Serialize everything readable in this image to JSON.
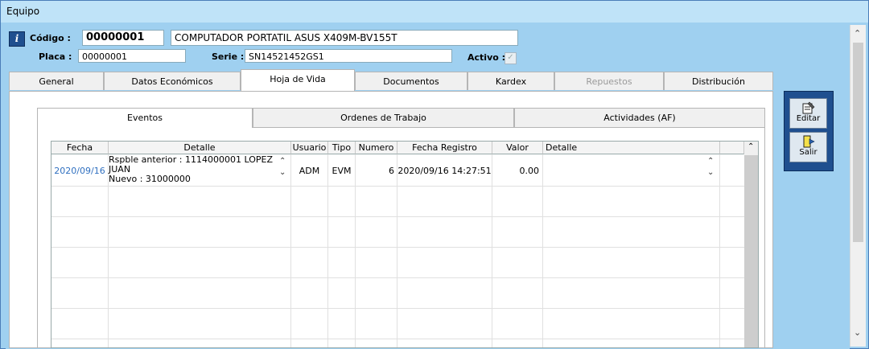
{
  "window": {
    "title": "Equipo"
  },
  "header": {
    "codigo_label": "Código :",
    "codigo_value": "00000001",
    "descripcion": "COMPUTADOR PORTATIL ASUS X409M-BV155T",
    "placa_label": "Placa :",
    "placa_value": "00000001",
    "serie_label": "Serie :",
    "serie_value": "SN14521452GS1",
    "activo_label": "Activo :",
    "activo_checked": true
  },
  "tabs": [
    "General",
    "Datos Económicos",
    "Hoja de Vida",
    "Documentos",
    "Kardex",
    "Repuestos",
    "Distribución"
  ],
  "active_tab": "Hoja de Vida",
  "subtabs": [
    "Eventos",
    "Ordenes de Trabajo",
    "Actividades (AF)"
  ],
  "active_subtab": "Eventos",
  "grid": {
    "columns": [
      "Fecha",
      "Detalle",
      "Usuario",
      "Tipo",
      "Numero",
      "Fecha Registro",
      "Valor",
      "Detalle"
    ],
    "rows": [
      {
        "fecha": "2020/09/16",
        "detalle_line1": "Rspble anterior : 1114000001 LOPEZ",
        "detalle_line2": "JUAN",
        "detalle_line3": "Nuevo : 31000000",
        "usuario": "ADM",
        "tipo": "EVM",
        "numero": "6",
        "fecha_registro": "2020/09/16 14:27:51",
        "valor": "0.00",
        "detalle2": ""
      }
    ]
  },
  "side_buttons": {
    "editar": "Editar",
    "salir": "Salir"
  },
  "icons": [
    "info-icon",
    "checkmark-icon",
    "edit-icon",
    "exit-icon",
    "chevron-up-icon",
    "chevron-down-icon"
  ]
}
